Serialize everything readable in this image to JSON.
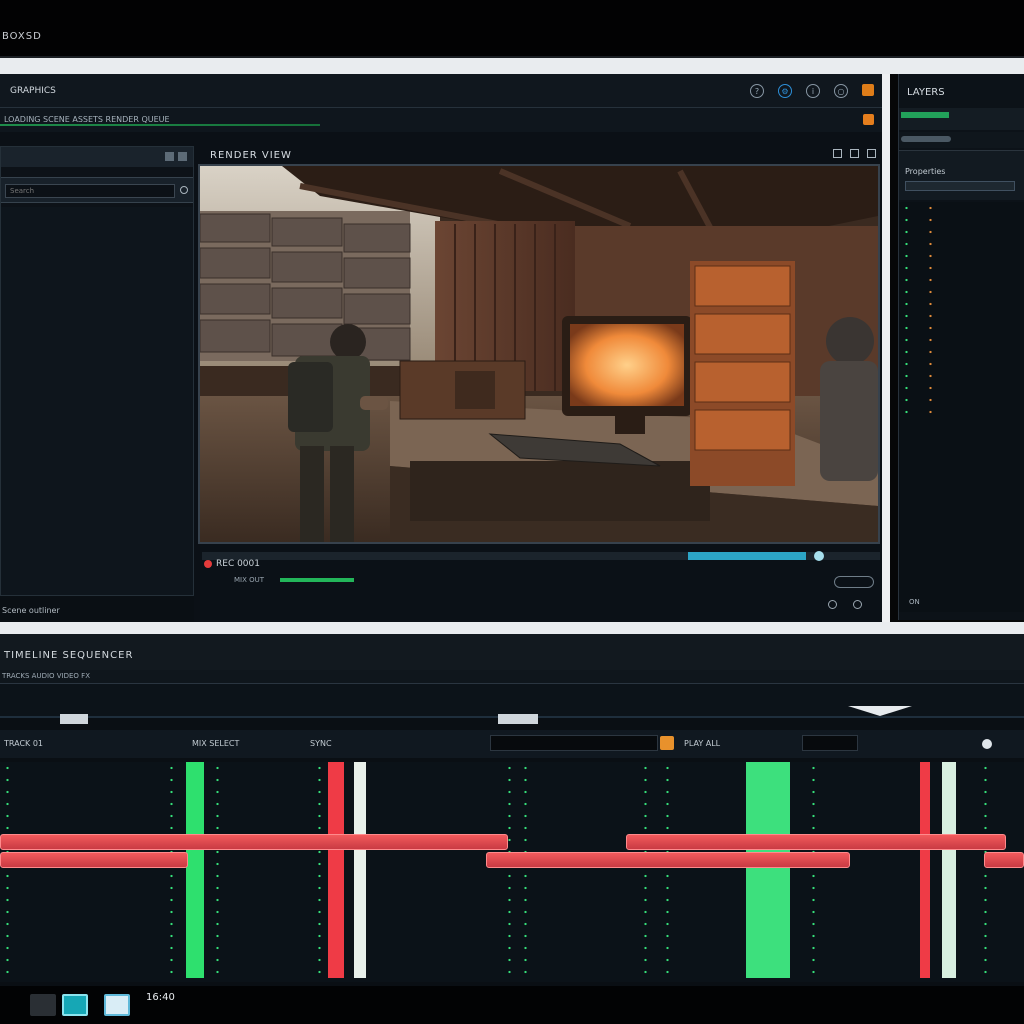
{
  "window": {
    "title": "BOXSD"
  },
  "main_panel": {
    "title": "GRAPHICS",
    "status_text": "LOADING SCENE ASSETS RENDER QUEUE",
    "left_panel": {
      "search_placeholder": "Search",
      "footer_label": "Scene outliner"
    },
    "viewport": {
      "title": "RENDER VIEW",
      "frame_label": "REC 0001",
      "small_label": "MIX OUT"
    }
  },
  "right_panel": {
    "title": "LAYERS",
    "filter_label": "Properties",
    "footer_label": "ON"
  },
  "timeline": {
    "title": "TIMELINE SEQUENCER",
    "sub_label": "TRACKS AUDIO VIDEO FX",
    "controls": {
      "left": "TRACK 01",
      "mid_a": "MIX SELECT",
      "mid_b": "SYNC",
      "right": "PLAY ALL"
    }
  },
  "taskbar": {
    "clock": "16:40"
  },
  "colors": {
    "accent_green": "#23b65a",
    "accent_red": "#e5484d",
    "accent_orange": "#e8912c",
    "accent_cyan": "#2ca5c6"
  },
  "icons": [
    "help-icon",
    "settings-icon",
    "info-icon",
    "notification-icon",
    "search-icon",
    "record-icon"
  ]
}
